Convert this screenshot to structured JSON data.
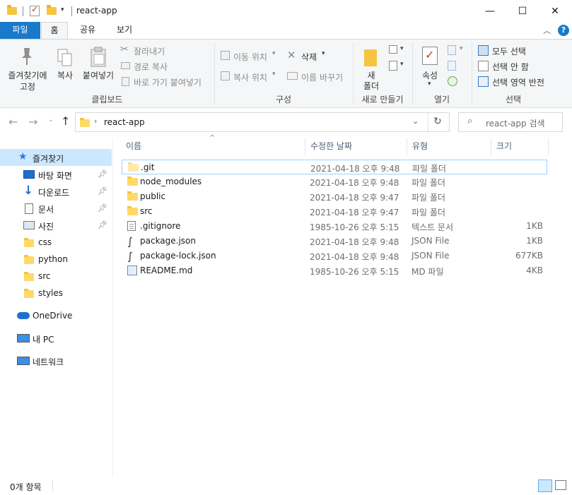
{
  "window": {
    "title": "react-app",
    "minimize": "—",
    "maximize": "☐",
    "close": "✕"
  },
  "tabs": [
    "파일",
    "홈",
    "공유",
    "보기"
  ],
  "ribbon": {
    "clipboard": {
      "label": "클립보드",
      "pin_label_1": "즐겨찾기에",
      "pin_label_2": "고정",
      "copy": "복사",
      "paste": "붙여넣기",
      "cut": "잘라내기",
      "copy_path": "경로 복사",
      "paste_shortcut": "바로 가기 붙여넣기"
    },
    "organize": {
      "label": "구성",
      "move_to": "이동 위치",
      "copy_to": "복사 위치",
      "delete": "삭제",
      "rename": "이름 바꾸기"
    },
    "new": {
      "label": "새로 만들기",
      "new_folder_1": "새",
      "new_folder_2": "폴더"
    },
    "open": {
      "label": "열기",
      "properties": "속성"
    },
    "select": {
      "label": "선택",
      "select_all": "모두 선택",
      "select_none": "선택 안 함",
      "invert": "선택 영역 반전"
    }
  },
  "address": {
    "path": "react-app",
    "search_placeholder": "react-app 검색"
  },
  "nav": {
    "quick_access": "즐겨찾기",
    "items": [
      {
        "label": "바탕 화면",
        "pinned": true
      },
      {
        "label": "다운로드",
        "pinned": true
      },
      {
        "label": "문서",
        "pinned": true
      },
      {
        "label": "사진",
        "pinned": true
      },
      {
        "label": "css",
        "pinned": false
      },
      {
        "label": "python",
        "pinned": false
      },
      {
        "label": "src",
        "pinned": false
      },
      {
        "label": "styles",
        "pinned": false
      }
    ],
    "onedrive": "OneDrive",
    "this_pc": "내 PC",
    "network": "네트워크"
  },
  "columns": {
    "name": "이름",
    "modified": "수정한 날짜",
    "type": "유형",
    "size": "크기"
  },
  "files": [
    {
      "name": ".git",
      "modified": "2021-04-18 오후 9:48",
      "type": "파일 폴더",
      "size": "",
      "kind": "folder-light"
    },
    {
      "name": "node_modules",
      "modified": "2021-04-18 오후 9:48",
      "type": "파일 폴더",
      "size": "",
      "kind": "folder"
    },
    {
      "name": "public",
      "modified": "2021-04-18 오후 9:47",
      "type": "파일 폴더",
      "size": "",
      "kind": "folder"
    },
    {
      "name": "src",
      "modified": "2021-04-18 오후 9:47",
      "type": "파일 폴더",
      "size": "",
      "kind": "folder"
    },
    {
      "name": ".gitignore",
      "modified": "1985-10-26 오후 5:15",
      "type": "텍스트 문서",
      "size": "1KB",
      "kind": "text"
    },
    {
      "name": "package.json",
      "modified": "2021-04-18 오후 9:48",
      "type": "JSON File",
      "size": "1KB",
      "kind": "json"
    },
    {
      "name": "package-lock.json",
      "modified": "2021-04-18 오후 9:48",
      "type": "JSON File",
      "size": "677KB",
      "kind": "json"
    },
    {
      "name": "README.md",
      "modified": "1985-10-26 오후 5:15",
      "type": "MD 파일",
      "size": "4KB",
      "kind": "md"
    }
  ],
  "status": {
    "count": "0개 항목"
  },
  "colors": {
    "accent": "#1979ca",
    "selection": "#cce8ff",
    "folder": "#ffd966"
  }
}
